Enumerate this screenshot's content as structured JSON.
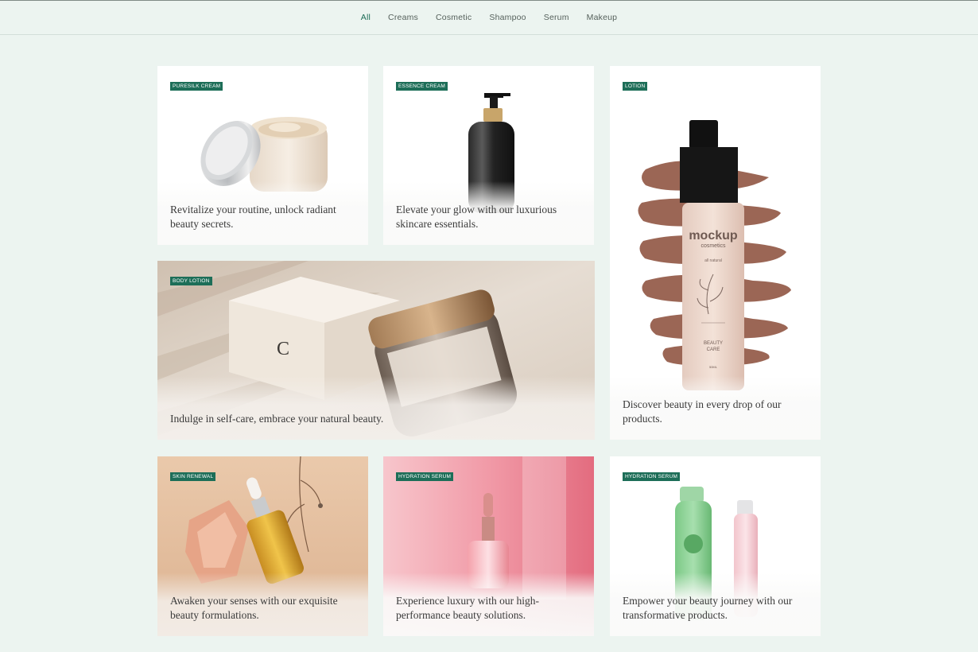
{
  "nav": {
    "items": [
      {
        "label": "All",
        "active": true
      },
      {
        "label": "Creams",
        "active": false
      },
      {
        "label": "Cosmetic",
        "active": false
      },
      {
        "label": "Shampoo",
        "active": false
      },
      {
        "label": "Serum",
        "active": false
      },
      {
        "label": "Makeup",
        "active": false
      }
    ]
  },
  "cards": [
    {
      "badge": "PURESILK CREAM",
      "caption": "Revitalize your routine, unlock radiant beauty secrets."
    },
    {
      "badge": "ESSENCE CREAM",
      "caption": "Elevate your glow with our luxurious skincare essentials."
    },
    {
      "badge": "LOTION",
      "caption": "Discover beauty in every drop of our products.",
      "product_text": {
        "brand": "mockup",
        "sub": "cosmetics",
        "natural": "all natural",
        "line1": "BEAUTY",
        "line2": "CARE",
        "volume": "50ML"
      }
    },
    {
      "badge": "BODY LOTION",
      "caption": "Indulge in self-care, embrace your natural beauty."
    },
    {
      "badge": "SKIN RENEWAL",
      "caption": "Awaken your senses with our exquisite beauty formulations."
    },
    {
      "badge": "HYDRATION SERUM",
      "caption": "Experience luxury with our high-performance beauty solutions."
    },
    {
      "badge": "HYDRATION SERUM",
      "caption": "Empower your beauty journey with our transformative products."
    }
  ],
  "colors": {
    "background": "#ecf4f0",
    "accent": "#1d6e58",
    "badge_text": "#ffffff",
    "caption_text": "#3a3a3a"
  }
}
